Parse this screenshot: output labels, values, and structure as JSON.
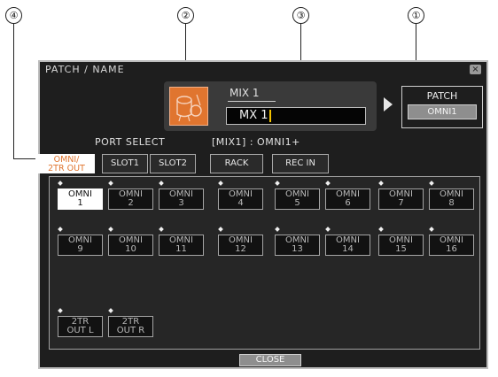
{
  "callouts": [
    "④",
    "②",
    "③",
    "①"
  ],
  "dialog": {
    "title": "PATCH / NAME",
    "close_icon": "×",
    "channel_label": "MIX 1",
    "name_value": "MX 1",
    "patch_label": "PATCH",
    "patch_value": "OMNI1",
    "port_select_label": "PORT SELECT",
    "port_status": "[MIX1] : OMNI1+",
    "close_button": "CLOSE"
  },
  "tabs": [
    {
      "line1": "OMNI/",
      "line2": "2TR OUT"
    },
    {
      "line1": "SLOT1",
      "line2": ""
    },
    {
      "line1": "SLOT2",
      "line2": ""
    },
    {
      "line1": "RACK",
      "line2": ""
    },
    {
      "line1": "REC IN",
      "line2": ""
    }
  ],
  "ports": [
    {
      "top": "OMNI",
      "bottom": "1"
    },
    {
      "top": "OMNI",
      "bottom": "2"
    },
    {
      "top": "OMNI",
      "bottom": "3"
    },
    {
      "top": "OMNI",
      "bottom": "4"
    },
    {
      "top": "OMNI",
      "bottom": "5"
    },
    {
      "top": "OMNI",
      "bottom": "6"
    },
    {
      "top": "OMNI",
      "bottom": "7"
    },
    {
      "top": "OMNI",
      "bottom": "8"
    },
    {
      "top": "OMNI",
      "bottom": "9"
    },
    {
      "top": "OMNI",
      "bottom": "10"
    },
    {
      "top": "OMNI",
      "bottom": "11"
    },
    {
      "top": "OMNI",
      "bottom": "12"
    },
    {
      "top": "OMNI",
      "bottom": "13"
    },
    {
      "top": "OMNI",
      "bottom": "14"
    },
    {
      "top": "OMNI",
      "bottom": "15"
    },
    {
      "top": "OMNI",
      "bottom": "16"
    },
    {
      "top": "2TR",
      "bottom": "OUT L"
    },
    {
      "top": "2TR",
      "bottom": "OUT R"
    }
  ],
  "colors": {
    "accent": "#e0752f",
    "background": "#1e1e1e"
  },
  "icons": {
    "channel": "drum-kit-icon",
    "arrow": "triangle-right-icon"
  }
}
